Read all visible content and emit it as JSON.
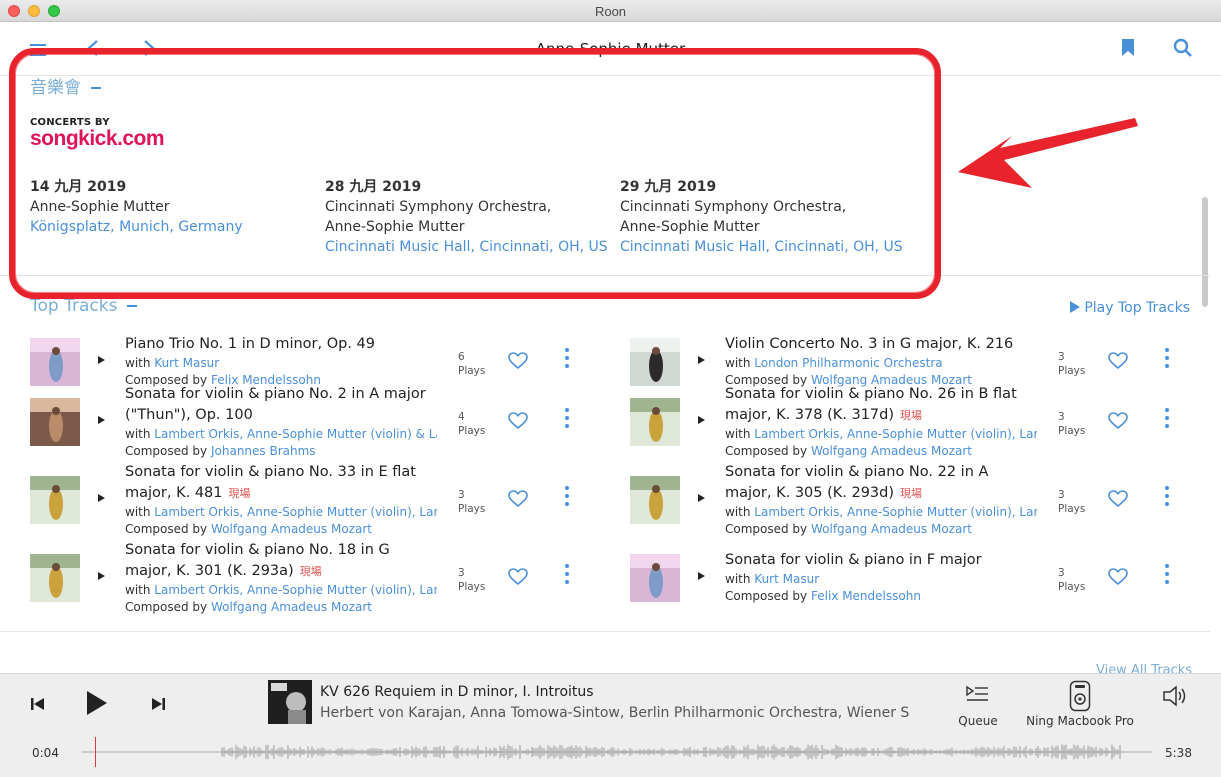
{
  "window": {
    "title": "Roon"
  },
  "header": {
    "title": "Anne-Sophie Mutter"
  },
  "concerts": {
    "heading": "音樂會",
    "provider_prefix": "CONCERTS BY",
    "provider_name": "songkick.com",
    "items": [
      {
        "date": "14 九月 2019",
        "artists": "Anne-Sophie Mutter",
        "venue": "Königsplatz, Munich, Germany"
      },
      {
        "date": "28 九月 2019",
        "artists": "Cincinnati Symphony Orchestra, Anne-Sophie Mutter",
        "venue": "Cincinnati Music Hall, Cincinnati, OH, US"
      },
      {
        "date": "29 九月 2019",
        "artists": "Cincinnati Symphony Orchestra, Anne-Sophie Mutter",
        "venue": "Cincinnati Music Hall, Cincinnati, OH, US"
      }
    ]
  },
  "top_tracks": {
    "heading": "Top Tracks",
    "play_label": "Play Top Tracks",
    "view_all": "View All Tracks",
    "with_prefix": "with",
    "composed_prefix": "Composed by",
    "plays_word": "Plays",
    "live_tag": "現場",
    "items": [
      {
        "title": "Piano Trio No. 1 in D minor, Op. 49",
        "live": false,
        "with": "Kurt Masur",
        "composer": "Felix Mendelssohn",
        "plays": "6"
      },
      {
        "title": "Violin Concerto No. 3 in G major, K. 216",
        "live": false,
        "with": "London Philharmonic Orchestra",
        "composer": "Wolfgang Amadeus Mozart",
        "plays": "3"
      },
      {
        "title": "Sonata for violin & piano No. 2 in A major (\"Thun\"), Op. 100",
        "live": false,
        "with": "Lambert Orkis, Anne-Sophie Mutter (violin) & Lambert Orkis (piano)",
        "composer": "Johannes Brahms",
        "plays": "4"
      },
      {
        "title": "Sonata for violin & piano No. 26 in B flat major, K. 378 (K. 317d)",
        "live": true,
        "with": "Lambert Orkis, Anne-Sophie Mutter (violin), Lambert Orkis",
        "composer": "Wolfgang Amadeus Mozart",
        "plays": "3"
      },
      {
        "title": "Sonata for violin & piano No. 33 in E flat major, K. 481",
        "live": true,
        "with": "Lambert Orkis, Anne-Sophie Mutter (violin), Lambert Orkis",
        "composer": "Wolfgang Amadeus Mozart",
        "plays": "3"
      },
      {
        "title": "Sonata for violin & piano No. 22 in A major, K. 305 (K. 293d)",
        "live": true,
        "with": "Lambert Orkis, Anne-Sophie Mutter (violin), Lambert Orkis",
        "composer": "Wolfgang Amadeus Mozart",
        "plays": "3"
      },
      {
        "title": "Sonata for violin & piano No. 18 in G major, K. 301 (K. 293a)",
        "live": true,
        "with": "Lambert Orkis, Anne-Sophie Mutter (violin), Lambert Orkis",
        "composer": "Wolfgang Amadeus Mozart",
        "plays": "3"
      },
      {
        "title": "Sonata for violin & piano in F major",
        "live": false,
        "with": "Kurt Masur",
        "composer": "Felix Mendelssohn",
        "plays": "3"
      }
    ]
  },
  "player": {
    "title": "KV 626 Requiem in D minor, I. Introitus",
    "artists": "Herbert von Karajan, Anna Tomowa-Sintow, Berlin Philharmonic Orchestra, Wiener Singverein",
    "queue_label": "Queue",
    "zone_label": "Ning Macbook Pro",
    "elapsed": "0:04",
    "duration": "5:38",
    "progress": 0.012
  },
  "colors": {
    "accent": "#4a90d9",
    "annotation": "#e8232c",
    "songkick": "#e0125a",
    "live": "#e05050"
  }
}
